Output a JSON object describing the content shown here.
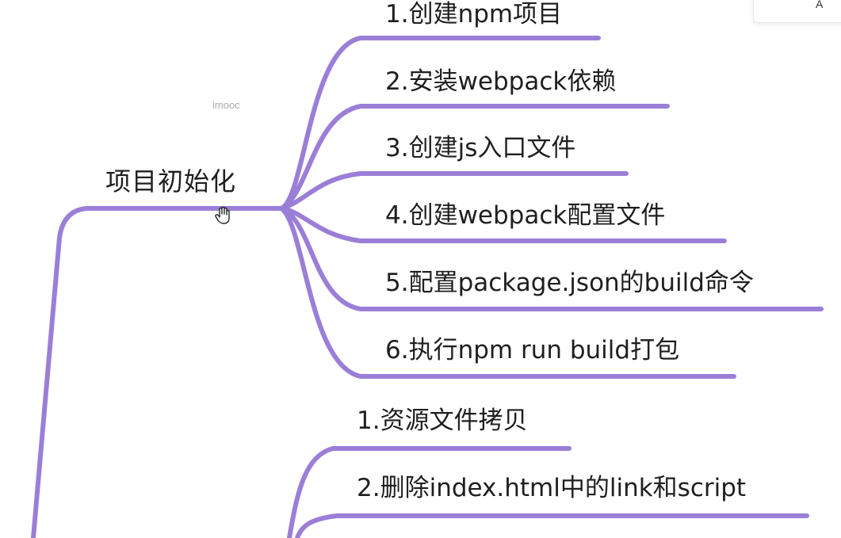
{
  "root": {
    "label": "项目初始化"
  },
  "group_one": {
    "items": [
      {
        "label": "1.创建npm项目"
      },
      {
        "label": "2.安装webpack依赖"
      },
      {
        "label": "3.创建js入口文件"
      },
      {
        "label": "4.创建webpack配置文件"
      },
      {
        "label": "5.配置package.json的build命令"
      },
      {
        "label": "6.执行npm run build打包"
      }
    ]
  },
  "group_two": {
    "items": [
      {
        "label": "1.资源文件拷贝"
      },
      {
        "label": "2.删除index.html中的link和script"
      }
    ]
  },
  "watermark": "imooc",
  "corner_card": {
    "text": "A"
  },
  "colors": {
    "branch": "#9b7ed8",
    "text": "#1f1f1f",
    "background": "#ffffff"
  },
  "icons": {
    "cursor": "hand-cursor-icon"
  }
}
